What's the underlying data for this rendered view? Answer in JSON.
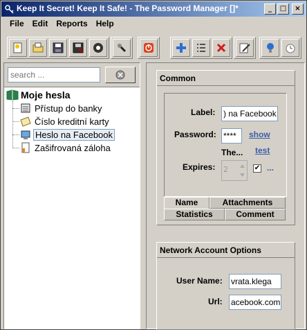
{
  "window": {
    "title": "Keep It Secret! Keep It Safe! - The Password Manager []*",
    "minimize": "_",
    "maximize": "□",
    "close": "×"
  },
  "menu": {
    "file": "File",
    "edit": "Edit",
    "reports": "Reports",
    "help": "Help"
  },
  "toolbar": {
    "icons": [
      "new-icon",
      "open-icon",
      "save-icon",
      "save-as-icon",
      "settings-icon",
      "search-tool-icon",
      "power-icon",
      "add-icon",
      "list-icon",
      "delete-icon",
      "edit-icon",
      "help-icon",
      "timer-icon"
    ]
  },
  "search": {
    "placeholder": "search ..."
  },
  "tree": {
    "root": "Moje hesla",
    "items": [
      {
        "label": "Přístup do banky",
        "icon": "bank-icon"
      },
      {
        "label": "Číslo kreditní karty",
        "icon": "credit-card-icon"
      },
      {
        "label": "Heslo na Facebook",
        "icon": "computer-icon"
      },
      {
        "label": "Zašifrovaná záloha",
        "icon": "document-icon"
      }
    ]
  },
  "common": {
    "title": "Common",
    "label_caption": "Label:",
    "label_value": ") na Facebook",
    "password_caption": "Password:",
    "password_value": "****",
    "show_link": "show",
    "test_link": "test",
    "strength": "The...",
    "expires_caption": "Expires:",
    "expires_value": "2",
    "ellipsis": "...",
    "tabs": [
      "Name",
      "Attachments",
      "Statistics",
      "Comment"
    ]
  },
  "network": {
    "title": "Network Account Options",
    "user_caption": "User Name:",
    "user_value": "vrata.klega",
    "url_caption": "Url:",
    "url_value": "acebook.com"
  },
  "colors": {
    "title_start": "#0a246a",
    "title_end": "#a6caf0",
    "link": "#3b5ea8",
    "face": "#d4d0c8"
  }
}
